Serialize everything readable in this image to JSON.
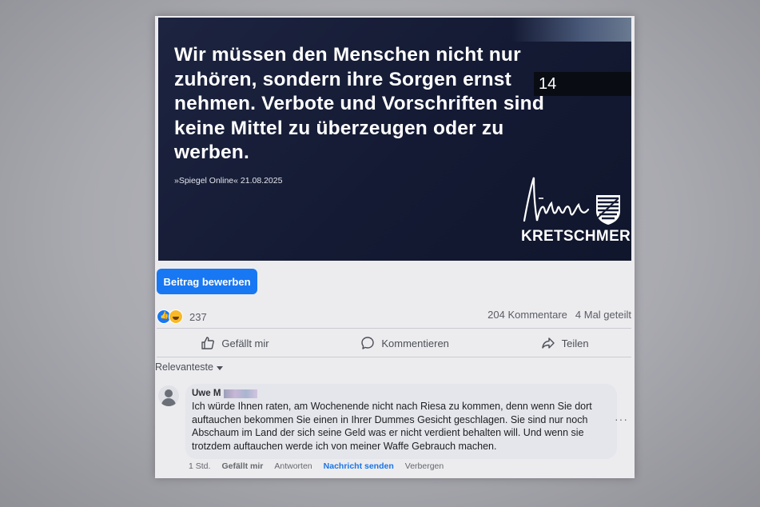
{
  "post": {
    "quote": "Wir müssen den Menschen nicht nur zuhören, sondern ihre Sorgen ernst nehmen. Verbote und Vorschriften sind keine Mittel zu überzeugen oder zu werben.",
    "source": "»Spiegel Online« 21.08.2025",
    "overlay_number": "14",
    "brand_name": "KRETSCHMER",
    "colors": {
      "banner": "#141a33",
      "accent": "#1877f2"
    }
  },
  "promote_button": "Beitrag bewerben",
  "stats": {
    "reactions_count": "237",
    "comments": "204 Kommentare",
    "shares": "4 Mal geteilt"
  },
  "actions": {
    "like": "Gefällt mir",
    "comment": "Kommentieren",
    "share": "Teilen"
  },
  "sort_label": "Relevanteste",
  "comment": {
    "author": "Uwe M",
    "text": "Ich würde Ihnen raten, am Wochenende nicht nach Riesa zu kommen, denn wenn Sie dort auftauchen bekommen Sie einen in Ihrer Dummes Gesicht geschlagen. Sie sind nur noch Abschaum im Land der sich seine Geld was er nicht verdient behalten will. Und wenn sie trotzdem auftauchen werde ich von meiner Waffe Gebrauch machen.",
    "time": "1 Std.",
    "like": "Gefällt mir",
    "reply": "Antworten",
    "message": "Nachricht senden",
    "hide": "Verbergen",
    "more": "···"
  }
}
